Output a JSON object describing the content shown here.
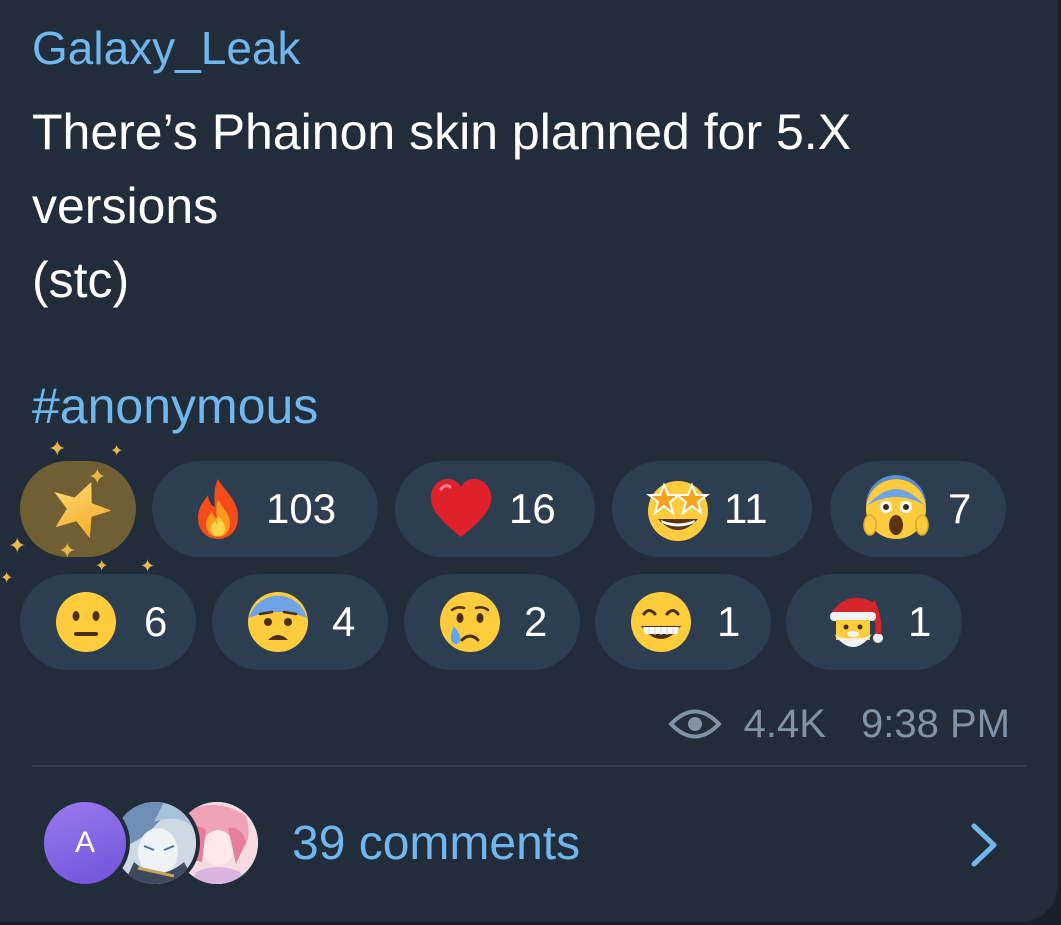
{
  "post": {
    "author": "Galaxy_Leak",
    "lines": [
      "There’s Phainon skin planned for 5.X",
      "versions",
      "(stc)"
    ],
    "hashtag": "#anonymous"
  },
  "reactions": {
    "featured": {
      "emoji": "star-icon",
      "color": "#6f5f33"
    },
    "items": [
      {
        "emoji": "fire-icon",
        "count": "103"
      },
      {
        "emoji": "red-heart-icon",
        "count": "16"
      },
      {
        "emoji": "star-struck-icon",
        "count": "11"
      },
      {
        "emoji": "screaming-face-icon",
        "count": "7"
      },
      {
        "emoji": "neutral-face-icon",
        "count": "6"
      },
      {
        "emoji": "anxious-face-icon",
        "count": "4"
      },
      {
        "emoji": "crying-face-icon",
        "count": "2"
      },
      {
        "emoji": "grinning-face-icon",
        "count": "1"
      },
      {
        "emoji": "santa-claus-icon",
        "count": "1"
      }
    ]
  },
  "meta": {
    "views": "4.4K",
    "time": "9:38 PM"
  },
  "comments": {
    "label": "39 comments",
    "avatar_initial": "A"
  },
  "colors": {
    "background": "#212d3b",
    "accent": "#71b7ee",
    "pill": "#2d3e50",
    "meta": "#8094a6"
  }
}
